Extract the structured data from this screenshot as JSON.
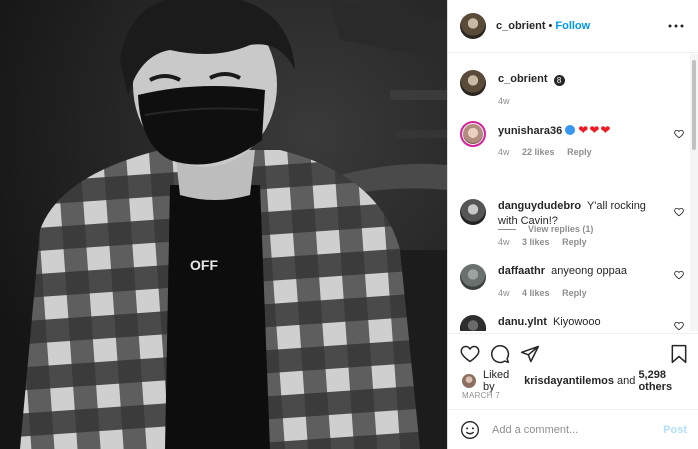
{
  "photo": {
    "shirt_text": "OFF"
  },
  "header": {
    "username": "c_obrient",
    "separator": "•",
    "follow_label": "Follow"
  },
  "caption": {
    "username": "c_obrient",
    "badge": "8",
    "time": "4w"
  },
  "comments": [
    {
      "username": "yunishara36",
      "verified": true,
      "text": "❤❤❤",
      "time": "4w",
      "likes": "22 likes",
      "reply": "Reply"
    },
    {
      "username": "danguydudebro",
      "text": "Y'all rocking with Cavin!?",
      "time": "4w",
      "likes": "3 likes",
      "reply": "Reply"
    },
    {
      "username": "daffaathr",
      "text": "anyeong oppaa",
      "time": "4w",
      "likes": "4 likes",
      "reply": "Reply"
    },
    {
      "username": "danu.ylnt",
      "text": "Kiyowooo"
    }
  ],
  "view_replies": "View replies (1)",
  "likes": {
    "prefix": "Liked by",
    "user": "krisdayantilemos",
    "and": "and",
    "others": "5,298 others"
  },
  "date": "MARCH 7",
  "add_comment": {
    "placeholder": "Add a comment...",
    "post_label": "Post"
  },
  "colors": {
    "accent": "#0095f6",
    "post_disabled": "#b2dffc",
    "heart": "#ed1c24",
    "muted": "#8e8e8e"
  },
  "icons": [
    "more-icon",
    "heart-icon",
    "comment-icon",
    "share-icon",
    "bookmark-icon",
    "emoji-icon",
    "verified-icon"
  ]
}
